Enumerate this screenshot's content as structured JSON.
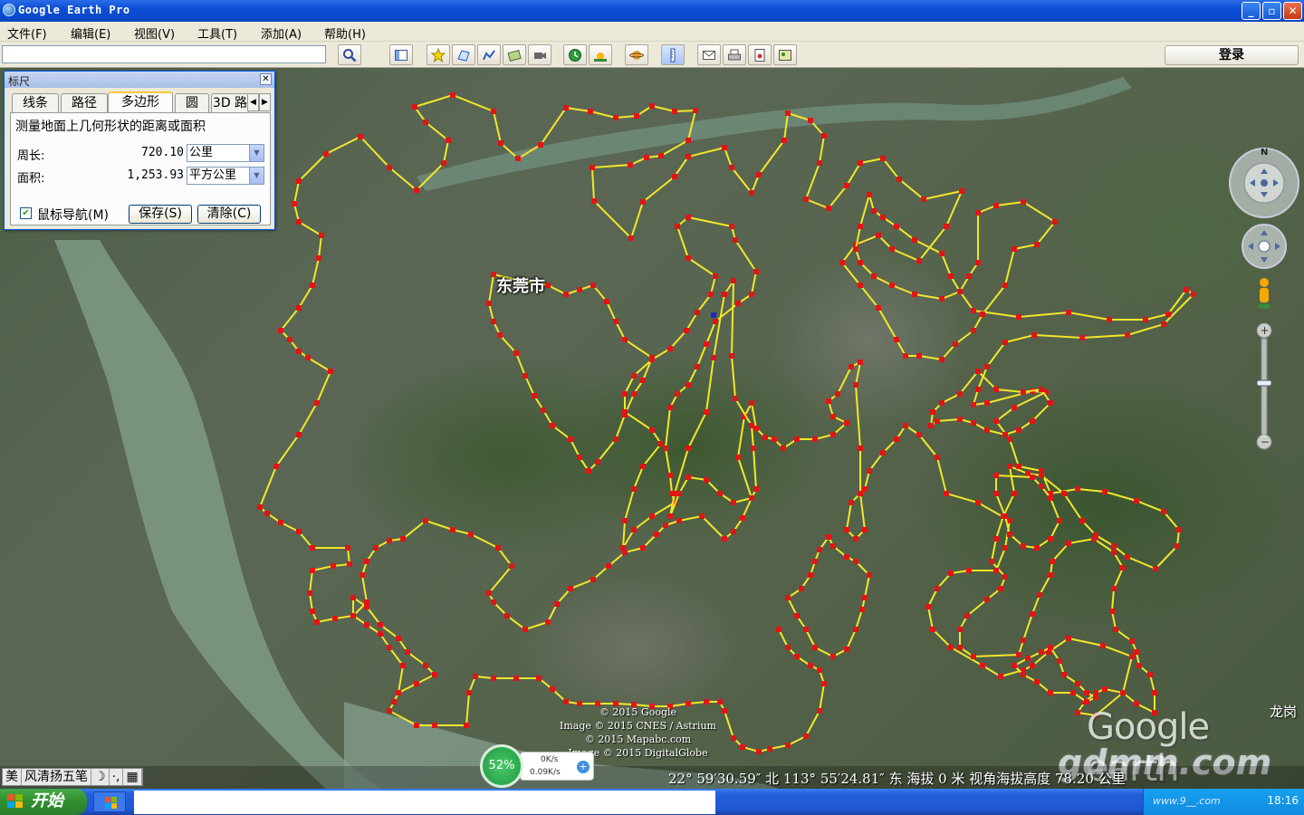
{
  "window": {
    "title": "Google Earth Pro",
    "buttons": {
      "minimize": "_",
      "maximize": "▫",
      "close": "✕"
    }
  },
  "menu": [
    {
      "label": "文件(F)",
      "name": "menu-file"
    },
    {
      "label": "编辑(E)",
      "name": "menu-edit"
    },
    {
      "label": "视图(V)",
      "name": "menu-view"
    },
    {
      "label": "工具(T)",
      "name": "menu-tools"
    },
    {
      "label": "添加(A)",
      "name": "menu-add"
    },
    {
      "label": "帮助(H)",
      "name": "menu-help"
    }
  ],
  "toolbar": {
    "search_value": "",
    "login_label": "登录",
    "icons": [
      "search-icon",
      "sidebar-icon",
      "placemark-icon",
      "polygon-icon",
      "path-icon",
      "image-overlay-icon",
      "record-tour-icon",
      "historical-imagery-icon",
      "sunlight-icon",
      "planets-icon",
      "ruler-icon",
      "email-icon",
      "print-icon",
      "save-image-icon",
      "view-in-maps-icon"
    ]
  },
  "ruler_dialog": {
    "title": "标尺",
    "close": "✕",
    "tabs": [
      "线条",
      "路径",
      "多边形",
      "圆",
      "3D 路"
    ],
    "active_tab": "多边形",
    "description": "测量地面上几何形状的距离或面积",
    "perimeter_label": "周长:",
    "perimeter_value": "720.10",
    "perimeter_unit": "公里",
    "area_label": "面积:",
    "area_value": "1,253.93",
    "area_unit": "平方公里",
    "mouse_nav_label": "鼠标导航(M)",
    "mouse_nav_checked": true,
    "save_label": "保存(S)",
    "clear_label": "清除(C)"
  },
  "map": {
    "city_label": "东莞市",
    "city_label_2": "龙岗",
    "copyright": [
      "© 2015 Google",
      "Image © 2015 CNES / Astrium",
      "© 2015 Mapabc.com",
      "Image © 2015 DigitalGlobe"
    ],
    "logo": "Google earth",
    "watermark": "gdmm.com",
    "polygon_line_color": "#f2e62a",
    "polygon_vertex_color": "#e01515"
  },
  "status": {
    "coordinates": "22° 59′30.59″ 北 113° 55′24.81″ 东 海拔   0 米   视角海拔高度  78.20 公里",
    "ime": [
      "美",
      "风清扬五笔",
      "☽",
      "·,",
      "▦"
    ]
  },
  "speed_widget": {
    "percent": "52%",
    "up": "0K/s",
    "down": "0.09K/s"
  },
  "taskbar": {
    "start_label": "开始",
    "clock": "18:16",
    "watermark": "www.9__.com"
  }
}
